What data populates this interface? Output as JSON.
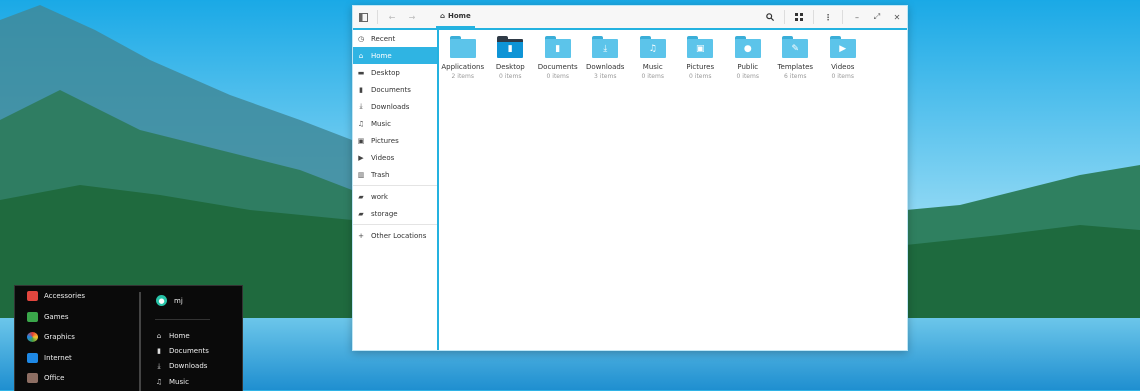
{
  "file_manager": {
    "path": {
      "home_icon": "home-icon",
      "label": "Home"
    },
    "sidebar": {
      "items": [
        {
          "label": "Recent",
          "icon": "clock-icon"
        },
        {
          "label": "Home",
          "icon": "home-icon",
          "active": true
        },
        {
          "label": "Desktop",
          "icon": "desktop-icon"
        },
        {
          "label": "Documents",
          "icon": "document-icon"
        },
        {
          "label": "Downloads",
          "icon": "download-icon"
        },
        {
          "label": "Music",
          "icon": "music-icon"
        },
        {
          "label": "Pictures",
          "icon": "picture-icon"
        },
        {
          "label": "Videos",
          "icon": "video-icon"
        },
        {
          "label": "Trash",
          "icon": "trash-icon"
        }
      ],
      "bookmarks": [
        {
          "label": "work",
          "icon": "folder-icon"
        },
        {
          "label": "storage",
          "icon": "folder-icon"
        }
      ],
      "other": {
        "label": "Other Locations",
        "icon": "plus-icon"
      }
    },
    "folders": [
      {
        "name": "Applications",
        "count": "2 items"
      },
      {
        "name": "Desktop",
        "count": "0 items"
      },
      {
        "name": "Documents",
        "count": "0 items"
      },
      {
        "name": "Downloads",
        "count": "3 items"
      },
      {
        "name": "Music",
        "count": "0 items"
      },
      {
        "name": "Pictures",
        "count": "0 items"
      },
      {
        "name": "Public",
        "count": "0 items"
      },
      {
        "name": "Templates",
        "count": "6 items"
      },
      {
        "name": "Videos",
        "count": "0 items"
      }
    ]
  },
  "start_menu": {
    "categories": [
      {
        "label": "Accessories",
        "color": "#e2463e"
      },
      {
        "label": "Games",
        "color": "#3aa64a"
      },
      {
        "label": "Graphics",
        "color": "#f1c232"
      },
      {
        "label": "Internet",
        "color": "#1e88e5"
      },
      {
        "label": "Office",
        "color": "#8d6e63"
      }
    ],
    "user": {
      "name": "mj"
    },
    "places": [
      {
        "label": "Home",
        "icon": "home-icon"
      },
      {
        "label": "Documents",
        "icon": "document-icon"
      },
      {
        "label": "Downloads",
        "icon": "download-icon"
      },
      {
        "label": "Music",
        "icon": "music-icon"
      }
    ]
  },
  "colors": {
    "accent": "#24b2e0",
    "folder": "#5cc4ea",
    "active_row": "#2fb4e3"
  }
}
